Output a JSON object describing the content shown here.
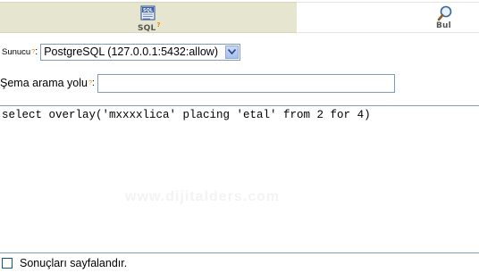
{
  "tabs": {
    "sql": {
      "label": "SQL",
      "help_mark": "?"
    },
    "find": {
      "label": "Bul"
    }
  },
  "form": {
    "server": {
      "label": "Sunucu",
      "help_mark": "?",
      "selected": "PostgreSQL (127.0.0.1:5432:allow)"
    },
    "schema_path": {
      "label": "Şema arama yolu",
      "help_mark": "?",
      "value": ""
    }
  },
  "sql": {
    "query": "select overlay('mxxxxlica' placing 'etal' from 2 for 4)"
  },
  "watermark": "www.dijitalders.com",
  "paging": {
    "label": "Sonuçları sayfalandır.",
    "checked": false
  },
  "colors": {
    "active_tab": "#e6e5cf",
    "input_border": "#7f9db9",
    "help_mark": "#e08a1a"
  }
}
